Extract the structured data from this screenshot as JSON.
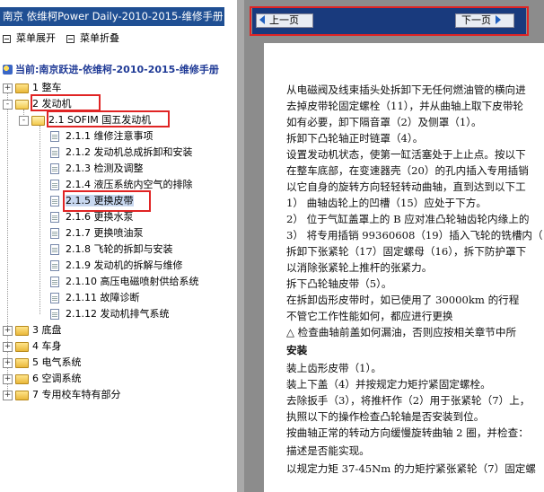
{
  "sidebar": {
    "title": "南京 依维柯Power Daily-2010-2015-维修手册",
    "expand_all": "菜单展开",
    "collapse_all": "菜单折叠",
    "current": "当前:南京跃进-依维柯-2010-2015-维修手册",
    "tree": [
      {
        "label": "1 整车",
        "exp": "+"
      },
      {
        "label": "2 发动机",
        "exp": "-"
      },
      {
        "label": "2.1 SOFIM 国五发动机",
        "exp": "-"
      },
      {
        "label": "2.1.1 维修注意事项"
      },
      {
        "label": "2.1.2 发动机总成拆卸和安装"
      },
      {
        "label": "2.1.3 检测及调整"
      },
      {
        "label": "2.1.4 液压系统内空气的排除"
      },
      {
        "label": "2.1.5 更换皮带"
      },
      {
        "label": "2.1.6 更换水泵"
      },
      {
        "label": "2.1.7 更换喷油泵"
      },
      {
        "label": "2.1.8 飞轮的拆卸与安装"
      },
      {
        "label": "2.1.9 发动机的拆解与维修"
      },
      {
        "label": "2.1.10 高压电磁喷射供给系统"
      },
      {
        "label": "2.1.11 故障诊断"
      },
      {
        "label": "2.1.12 发动机排气系统"
      },
      {
        "label": "3 底盘",
        "exp": "+"
      },
      {
        "label": "4 车身",
        "exp": "+"
      },
      {
        "label": "5 电气系统",
        "exp": "+"
      },
      {
        "label": "6 空调系统",
        "exp": "+"
      },
      {
        "label": "7 专用校车特有部分",
        "exp": "+"
      }
    ]
  },
  "viewer": {
    "prev_label": "上一页",
    "next_label": "下一页",
    "lines": [
      "从电磁阀及线束插头处拆卸下无任何燃油管的横向进",
      "去掉皮带轮固定螺栓（11），并从曲轴上取下皮带轮",
      "如有必要，卸下隔音罩（2）及侧罩（1）。",
      "拆卸下凸轮轴正时链罩（4）。",
      "设置发动机状态，使第一缸活塞处于上止点。按以下",
      "在整车底部，在变速器壳（20）的孔内插入专用插销",
      "以它自身的旋转方向轻轻转动曲轴，直到达到以下工",
      "1） 曲轴齿轮上的凹槽（15）应处于下方。",
      "2） 位于气缸盖罩上的 B 应对准凸轮轴齿轮内缘上的",
      "3） 将专用插销 99360608（19）插入飞轮的铣槽内（",
      "拆卸下张紧轮（17）固定螺母（16），拆下防护罩下",
      "以消除张紧轮上推杆的张紧力。",
      "拆下凸轮轴皮带（5）。",
      "在拆卸齿形皮带时，如已使用了 30000km 的行程",
      "不管它工作性能如何，都应进行更换",
      "△  检查曲轴前盖如何漏油，否则应按相关章节中所",
      "安装",
      "装上齿形皮带（1）。",
      "装上下盖（4）并按规定力矩拧紧固定螺栓。",
      "去除扳手（3），将推杆作（2）用于张紧轮（7）上，",
      "执照以下的操作检查凸轮轴是否安装到位。",
      "按曲轴正常的转动方向缓慢旋转曲轴 2 圈，并检查：",
      "描述是否能实现。",
      "以规定力矩 37-45Nm 的力矩拧紧张紧轮（7）固定螺"
    ]
  },
  "colors": {
    "title_bar": "#1f4f93",
    "nav_bar": "#193a7d",
    "highlight": "#e02424",
    "current_text": "#1f3a96",
    "viewer_bg": "#8c8c8c"
  }
}
